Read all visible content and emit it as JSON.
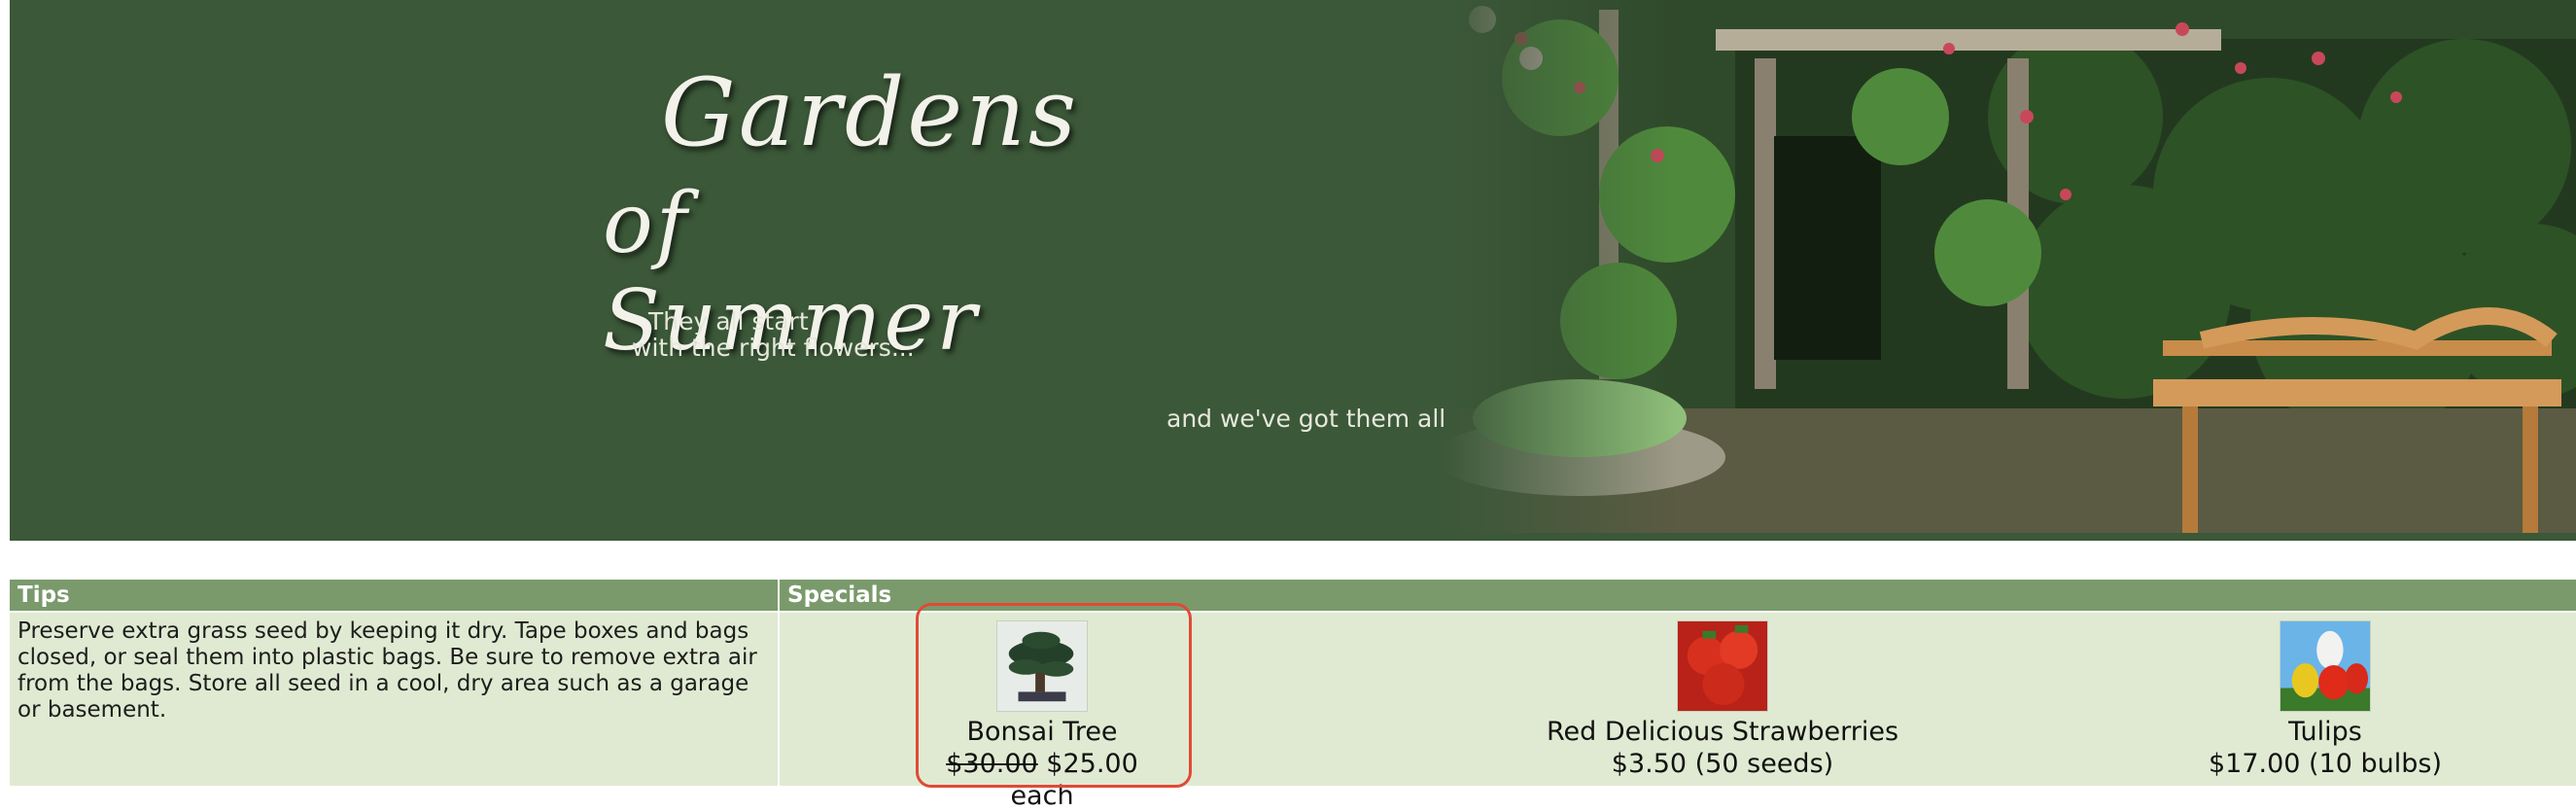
{
  "banner": {
    "logo_line1": "Gardens",
    "logo_line2": "of Summer",
    "tagline_line1": "They all start",
    "tagline_line2": "with the right flowers...",
    "tagline_line3": "and we've got them all"
  },
  "tips": {
    "header": "Tips",
    "text": "Preserve extra grass seed by keeping it dry. Tape boxes and bags closed, or seal them into plastic bags. Be sure to remove extra air from the bags. Store all seed in a cool, dry area such as a garage or basement."
  },
  "specials": {
    "header": "Specials",
    "items": [
      {
        "name": "Bonsai Tree",
        "old_price": "$30.00",
        "price": "$25.00 each",
        "icon": "bonsai-tree-icon"
      },
      {
        "name": "Red Delicious Strawberries",
        "price": "$3.50 (50 seeds)",
        "icon": "strawberries-icon"
      },
      {
        "name": "Tulips",
        "price": "$17.00 (10 bulbs)",
        "icon": "tulips-icon"
      }
    ]
  },
  "colors": {
    "banner_bg": "#3b5838",
    "header_bg": "#7a9a6c",
    "cell_bg": "#e0ead2",
    "highlight": "#e04a36"
  }
}
